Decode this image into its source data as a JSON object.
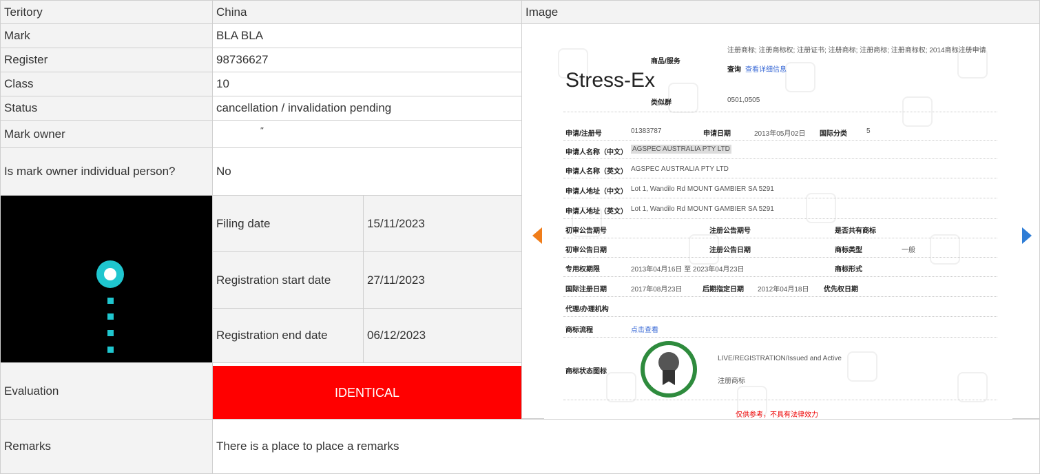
{
  "rows": {
    "territory": {
      "label": "Teritory",
      "value": "China"
    },
    "mark": {
      "label": "Mark",
      "value": "BLA BLA"
    },
    "register": {
      "label": "Register",
      "value": "98736627"
    },
    "class": {
      "label": "Class",
      "value": "10"
    },
    "status": {
      "label": "Status",
      "value": "cancellation / invalidation pending"
    },
    "owner": {
      "label": "Mark owner",
      "value": "‴"
    },
    "individual": {
      "label": "Is mark owner individual person?",
      "value": "No"
    }
  },
  "image_header": "Image",
  "dates": {
    "filing": {
      "label": "Filing date",
      "value": "15/11/2023"
    },
    "reg_start": {
      "label": "Registration start date",
      "value": "27/11/2023"
    },
    "reg_end": {
      "label": "Registration end date",
      "value": "06/12/2023"
    }
  },
  "evaluation": {
    "label": "Evaluation",
    "value": "IDENTICAL",
    "color": "#ff0000"
  },
  "remarks": {
    "label": "Remarks",
    "value": "There is a place to place a remarks"
  },
  "certificate": {
    "title": "Stress-Ex",
    "goods_label": "商品/服务",
    "goods_text": "注册商标; 注册商标权; 注册证书; 注册商标; 注册商标; 注册商标权; 2014商标注册申请",
    "goods_link_label": "查询",
    "goods_link": "查看详细信息",
    "similar_group_label": "类似群",
    "similar_group": "0501,0505",
    "app_no_label": "申请/注册号",
    "app_no": "01383787",
    "app_date_label": "申请日期",
    "app_date": "2013年05月02日",
    "intl_class_label": "国际分类",
    "intl_class": "5",
    "applicant_cn_label": "申请人名称（中文）",
    "applicant_cn": "AGSPEC AUSTRALIA PTY LTD",
    "applicant_en_label": "申请人名称（英文）",
    "applicant_en": "AGSPEC AUSTRALIA PTY LTD",
    "address_cn_label": "申请人地址（中文）",
    "address_cn": "Lot 1, Wandilo Rd MOUNT GAMBIER SA 5291",
    "address_en_label": "申请人地址（英文）",
    "address_en": "Lot 1, Wandilo Rd MOUNT GAMBIER SA 5291",
    "prelim_no_label": "初审公告期号",
    "reg_no_label": "注册公告期号",
    "shared_label": "是否共有商标",
    "prelim_date_label": "初审公告日期",
    "reg_date_label": "注册公告日期",
    "mark_type_label": "商标类型",
    "mark_type": "一般",
    "exclusive_label": "专用权期限",
    "exclusive": "2013年04月16日 至 2023年04月23日",
    "form_label": "商标形式",
    "intl_reg_label": "国际注册日期",
    "intl_reg": "2017年08月23日",
    "later_label": "后期指定日期",
    "later": "2012年04月18日",
    "priority_label": "优先权日期",
    "agent_label": "代理/办理机构",
    "process_label": "商标流程",
    "process_link": "点击查看",
    "status_label": "商标状态图标",
    "status_text": "LIVE/REGISTRATION/Issued and Active",
    "status_sub": "注册商标",
    "footer": "仅供参考，不具有法律效力"
  }
}
